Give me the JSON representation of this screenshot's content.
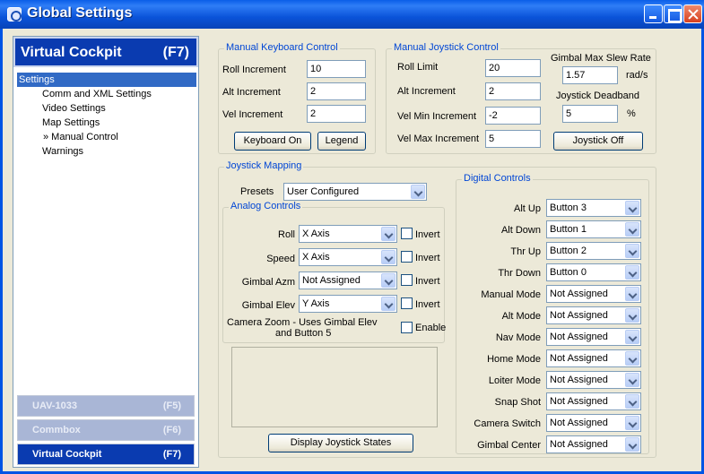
{
  "window": {
    "title": "Global Settings"
  },
  "left": {
    "header_title": "Virtual Cockpit",
    "header_key": "(F7)",
    "tree": [
      {
        "label": "Settings",
        "selected": true
      },
      {
        "label": "Comm and XML Settings"
      },
      {
        "label": "Video Settings"
      },
      {
        "label": "Map Settings"
      },
      {
        "label": "» Manual Control"
      },
      {
        "label": "Warnings"
      }
    ],
    "nav": [
      {
        "label": "UAV-1033",
        "key": "(F5)"
      },
      {
        "label": "Commbox",
        "key": "(F6)"
      },
      {
        "label": "Virtual Cockpit",
        "key": "(F7)"
      }
    ]
  },
  "keyboard": {
    "legend": "Manual Keyboard Control",
    "roll_label": "Roll Increment",
    "roll_value": "10",
    "alt_label": "Alt Increment",
    "alt_value": "2",
    "vel_label": "Vel Increment",
    "vel_value": "2",
    "on_button": "Keyboard On",
    "legend_button": "Legend"
  },
  "joystick": {
    "legend": "Manual Joystick Control",
    "roll_label": "Roll Limit",
    "roll_value": "20",
    "alt_label": "Alt Increment",
    "alt_value": "2",
    "velmin_label": "Vel Min Increment",
    "velmin_value": "-2",
    "velmax_label": "Vel Max Increment",
    "velmax_value": "5",
    "slew_label": "Gimbal Max Slew Rate",
    "slew_value": "1.57",
    "slew_unit": "rad/s",
    "deadband_label": "Joystick Deadband",
    "deadband_value": "5",
    "deadband_unit": "%",
    "off_button": "Joystick Off"
  },
  "mapping": {
    "legend": "Joystick Mapping",
    "presets_label": "Presets",
    "presets_value": "User Configured",
    "analog_legend": "Analog Controls",
    "analog": [
      {
        "label": "Roll",
        "value": "X Axis",
        "check": "Invert"
      },
      {
        "label": "Speed",
        "value": "X Axis",
        "check": "Invert"
      },
      {
        "label": "Gimbal Azm",
        "value": "Not Assigned",
        "check": "Invert"
      },
      {
        "label": "Gimbal Elev",
        "value": "Y Axis",
        "check": "Invert"
      }
    ],
    "zoom_label_1": "Camera Zoom - Uses Gimbal Elev",
    "zoom_label_2": "and Button 5",
    "zoom_check": "Enable",
    "display_button": "Display Joystick States",
    "digital_legend": "Digital Controls",
    "digital": [
      {
        "label": "Alt Up",
        "value": "Button 3"
      },
      {
        "label": "Alt Down",
        "value": "Button 1"
      },
      {
        "label": "Thr Up",
        "value": "Button 2"
      },
      {
        "label": "Thr Down",
        "value": "Button 0"
      },
      {
        "label": "Manual Mode",
        "value": "Not Assigned"
      },
      {
        "label": "Alt Mode",
        "value": "Not Assigned"
      },
      {
        "label": "Nav Mode",
        "value": "Not Assigned"
      },
      {
        "label": "Home Mode",
        "value": "Not Assigned"
      },
      {
        "label": "Loiter Mode",
        "value": "Not Assigned"
      },
      {
        "label": "Snap Shot",
        "value": "Not Assigned"
      },
      {
        "label": "Camera Switch",
        "value": "Not Assigned"
      },
      {
        "label": "Gimbal Center",
        "value": "Not Assigned"
      }
    ]
  }
}
